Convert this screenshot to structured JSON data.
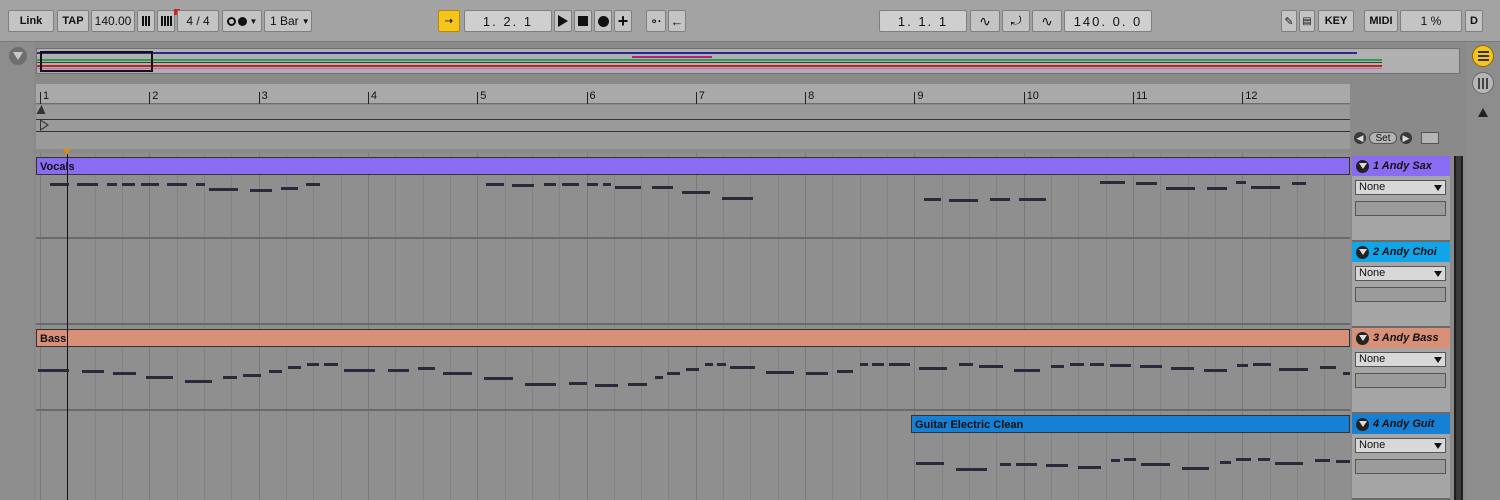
{
  "transport": {
    "link_label": "Link",
    "tap_label": "TAP",
    "tempo": "140.00",
    "time_signature": "4 / 4",
    "quantize": "1 Bar",
    "position": "1.   2.   1",
    "loop_start": "1.   1.   1",
    "loop_length": "140.   0.   0",
    "key_label": "KEY",
    "midi_label": "MIDI",
    "cpu_load": "1 %",
    "d_label": "D"
  },
  "ruler": {
    "bars": [
      "1",
      "2",
      "3",
      "4",
      "5",
      "6",
      "7",
      "8",
      "9",
      "10",
      "11",
      "12"
    ]
  },
  "locator": {
    "set_label": "Set"
  },
  "colors": {
    "vocals": "#8a6cf2",
    "choir": "#10a5e8",
    "bass": "#d89078",
    "guitar": "#1580d4",
    "accent": "#f5c51b"
  },
  "clips": {
    "vocals": "Vocals",
    "bass": "Bass",
    "guitar": "Guitar Electric Clean"
  },
  "tracks": [
    {
      "name": "1 Andy Sax",
      "input": "None",
      "color": "#8a6cf2"
    },
    {
      "name": "2 Andy Choi",
      "input": "None",
      "color": "#10a5e8"
    },
    {
      "name": "3 Andy Bass",
      "input": "None",
      "color": "#d89078"
    },
    {
      "name": "4 Andy Guit",
      "input": "None",
      "color": "#1580d4"
    }
  ]
}
